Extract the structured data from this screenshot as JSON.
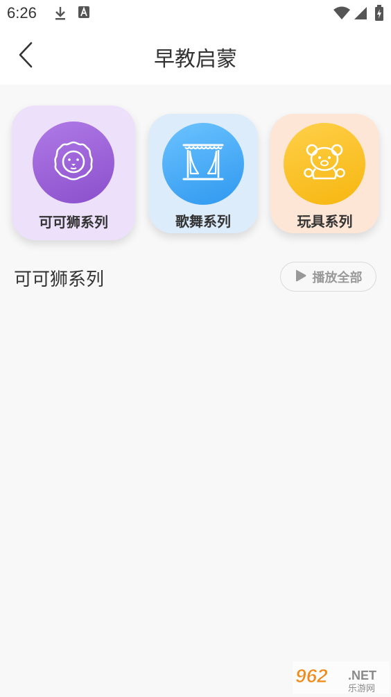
{
  "status_bar": {
    "time": "6:26",
    "icons": [
      "download-icon",
      "font-icon",
      "wifi-icon",
      "signal-icon",
      "battery-charging-icon"
    ]
  },
  "header": {
    "back_icon": "chevron-left-icon",
    "title": "早教启蒙"
  },
  "categories": [
    {
      "label": "可可狮系列",
      "icon": "lion-icon",
      "card_color": "#eee0fb",
      "circle_color": "#9a5fd8"
    },
    {
      "label": "歌舞系列",
      "icon": "stage-curtain-icon",
      "card_color": "#dfeefb",
      "circle_color": "#45aaf5"
    },
    {
      "label": "玩具系列",
      "icon": "teddy-bear-icon",
      "card_color": "#fde8d8",
      "circle_color": "#fcc02e"
    }
  ],
  "section": {
    "title": "可可狮系列",
    "play_all_label": "播放全部",
    "play_icon": "play-icon"
  },
  "watermark": {
    "brand": "962",
    "suffix": ".NET",
    "subtitle": "乐游网"
  }
}
